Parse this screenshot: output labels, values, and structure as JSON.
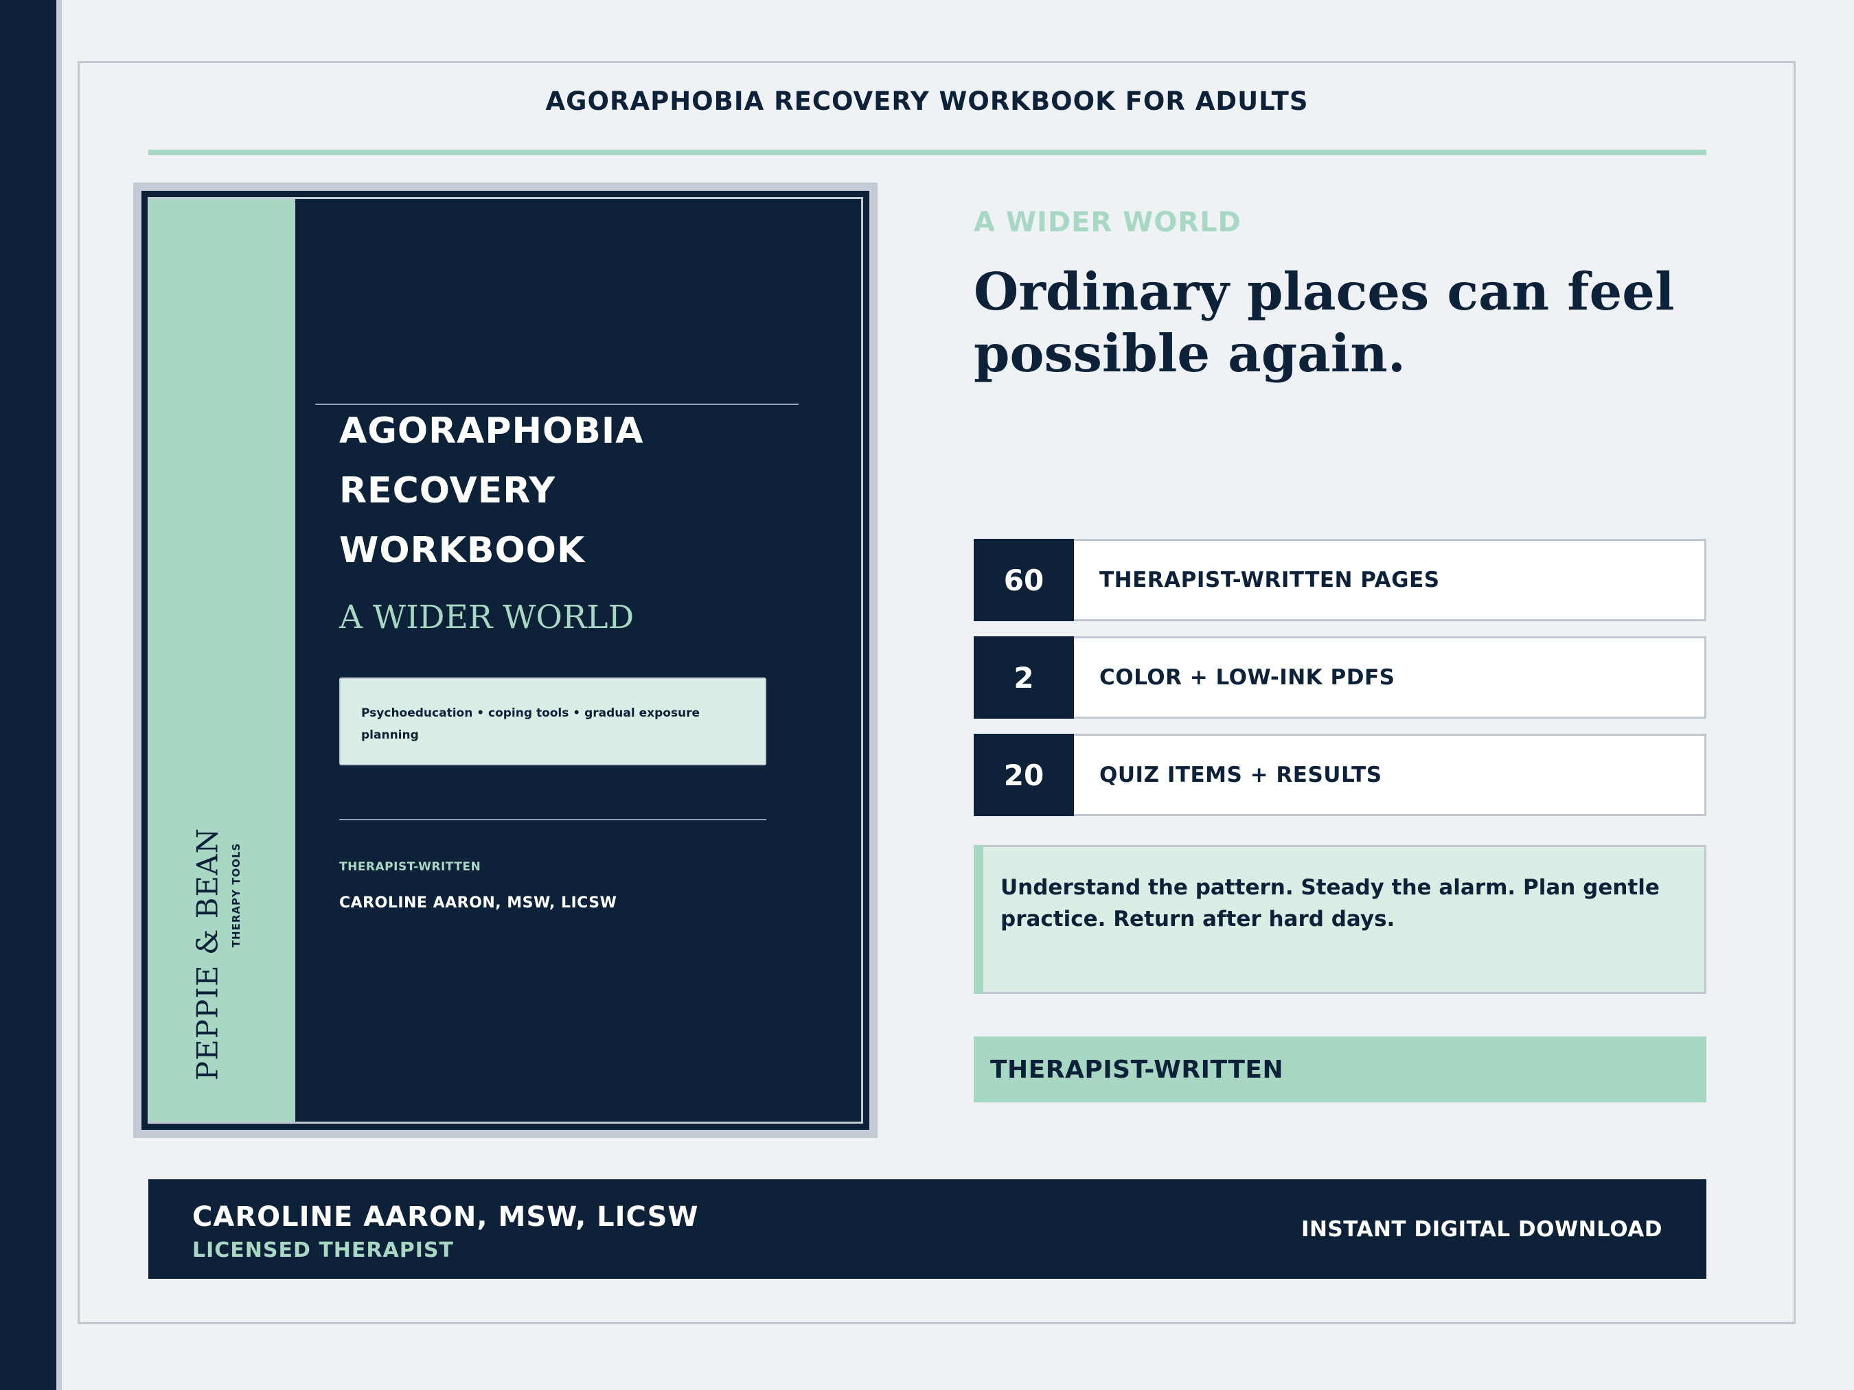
{
  "header": {
    "title": "AGORAPHOBIA RECOVERY WORKBOOK FOR ADULTS"
  },
  "cover": {
    "brand": "PEPPIE & BEAN",
    "brand_sub": "THERAPY TOOLS",
    "title_lines": [
      "AGORAPHOBIA",
      "RECOVERY",
      "WORKBOOK"
    ],
    "subtitle": "A WIDER WORLD",
    "box_text": "Psychoeducation • coping tools • gradual exposure planning",
    "tag": "THERAPIST-WRITTEN",
    "author": "CAROLINE AARON, MSW, LICSW"
  },
  "hero": {
    "eyebrow": "A WIDER WORLD",
    "headline": "Ordinary places can feel possible again."
  },
  "stats": [
    {
      "number": "60",
      "label": "THERAPIST-WRITTEN PAGES"
    },
    {
      "number": "2",
      "label": "COLOR + LOW-INK PDFS"
    },
    {
      "number": "20",
      "label": "QUIZ ITEMS + RESULTS"
    }
  ],
  "quote": "Understand the pattern. Steady the alarm. Plan gentle practice. Return after hard days.",
  "tag_bar": "THERAPIST-WRITTEN",
  "footer": {
    "name": "CAROLINE AARON, MSW, LICSW",
    "role": "LICENSED THERAPIST",
    "cta": "INSTANT DIGITAL DOWNLOAD"
  },
  "colors": {
    "navy": "#0d2239",
    "mint": "#a8d8c4",
    "mint_light": "#daeee6",
    "background": "#eef2f5",
    "border": "#c0c7cf"
  }
}
